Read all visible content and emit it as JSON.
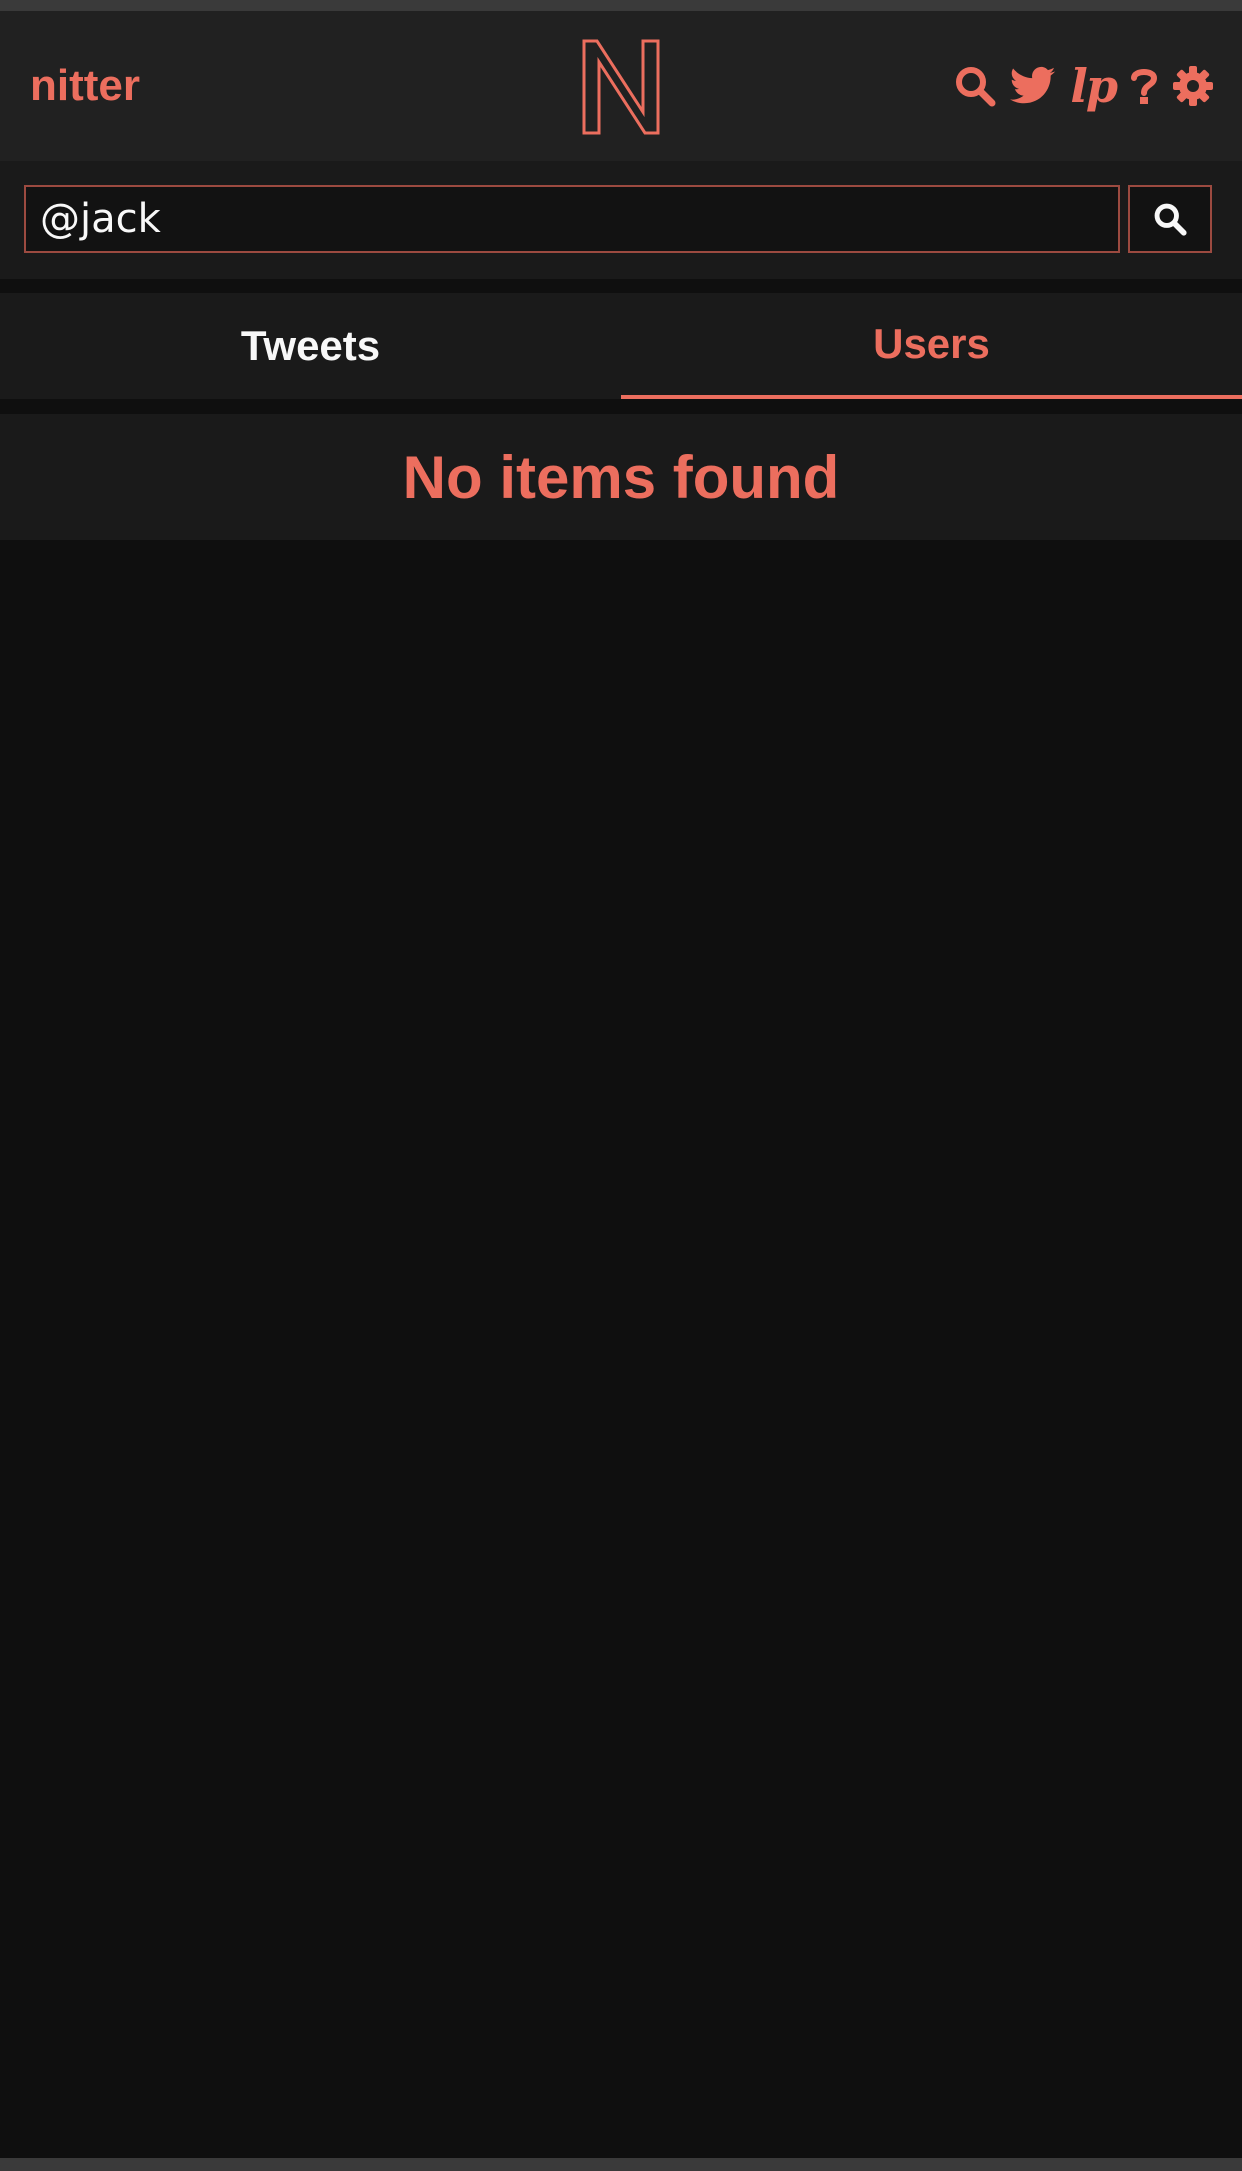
{
  "header": {
    "brand": "nitter",
    "logo_icon": "nitter-n-logo-icon",
    "icons": [
      "search-icon",
      "twitter-bird-icon",
      "lp-icon",
      "help-icon",
      "gear-icon"
    ],
    "lp_label": "lp",
    "help_label": "?"
  },
  "search": {
    "value": "@jack",
    "button_icon": "search-icon"
  },
  "tabs": [
    {
      "label": "Tweets",
      "active": false
    },
    {
      "label": "Users",
      "active": true
    }
  ],
  "results": {
    "message": "No items found"
  },
  "colors": {
    "accent": "#ec6e5e",
    "background": "#0f0f0f",
    "panel": "#1a1a1a",
    "navbar": "#212121",
    "text": "#f8f8f8"
  }
}
